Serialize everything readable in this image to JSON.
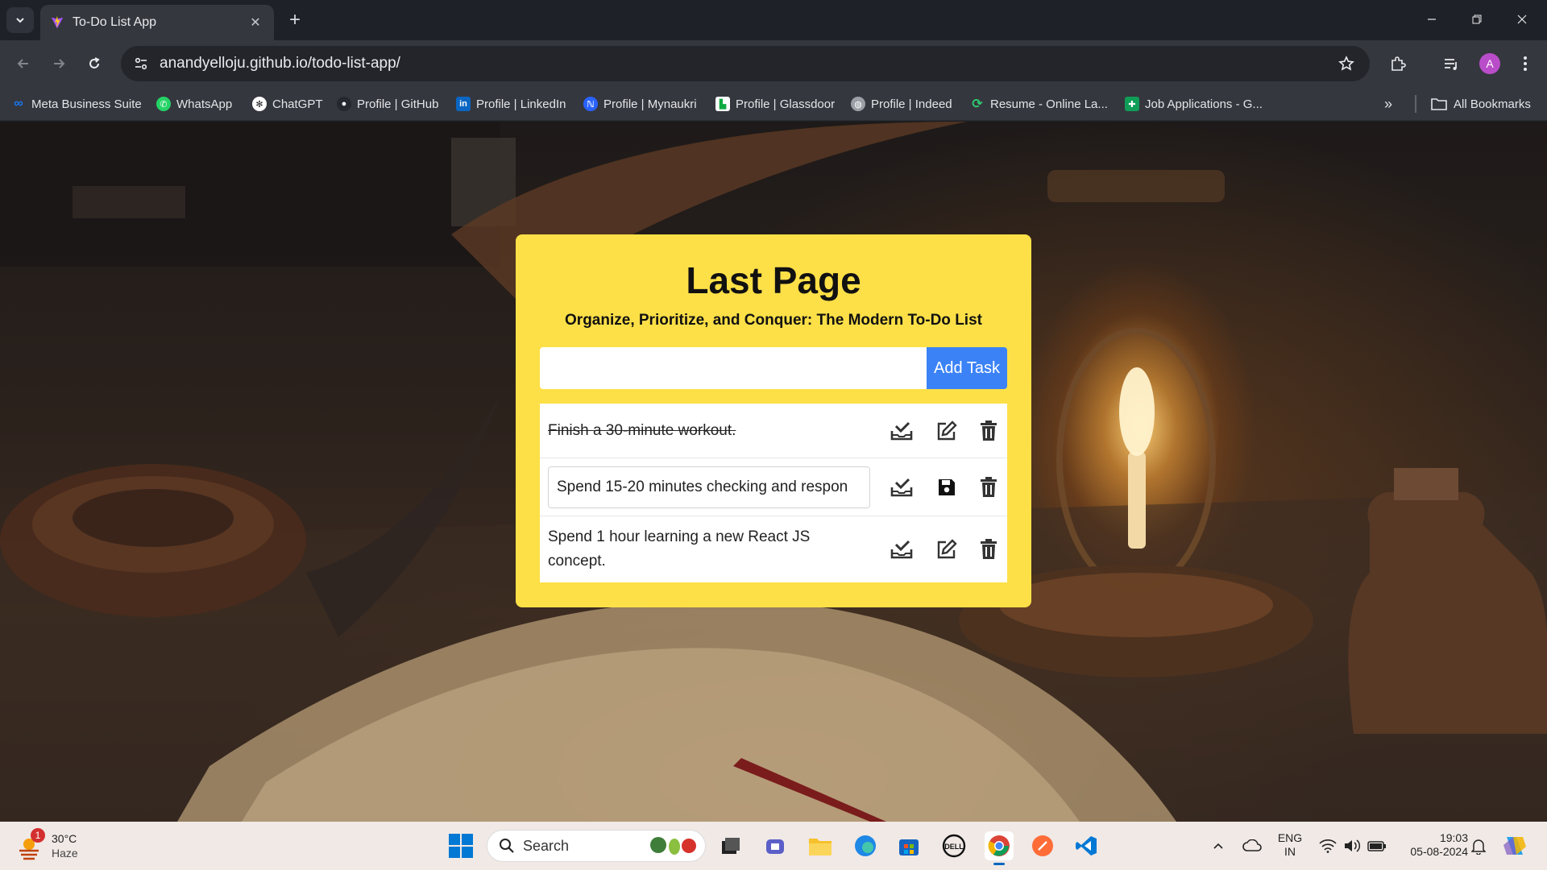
{
  "browser": {
    "tab_title": "To-Do List App",
    "url": "anandyelloju.github.io/todo-list-app/",
    "avatar_letter": "A",
    "bookmarks": [
      {
        "label": "Meta Business Suite",
        "icon": "meta-icon",
        "color": "#1877f2"
      },
      {
        "label": "WhatsApp",
        "icon": "whatsapp-icon",
        "color": "#25d366"
      },
      {
        "label": "ChatGPT",
        "icon": "chatgpt-icon",
        "color": "#e8eaed"
      },
      {
        "label": "Profile | GitHub",
        "icon": "github-icon",
        "color": "#24292f"
      },
      {
        "label": "Profile | LinkedIn",
        "icon": "linkedin-icon",
        "color": "#0a66c2"
      },
      {
        "label": "Profile | Mynaukri",
        "icon": "naukri-icon",
        "color": "#2962ff"
      },
      {
        "label": "Profile | Glassdoor",
        "icon": "glassdoor-icon",
        "color": "#0caa41"
      },
      {
        "label": "Profile | Indeed",
        "icon": "indeed-icon",
        "color": "#9aa0a6"
      },
      {
        "label": "Resume - Online La...",
        "icon": "resume-icon",
        "color": "#2ecc71"
      },
      {
        "label": "Job Applications - G...",
        "icon": "sheets-icon",
        "color": "#0f9d58"
      }
    ],
    "all_bookmarks_label": "All Bookmarks"
  },
  "app": {
    "title": "Last Page",
    "subtitle": "Organize, Prioritize, and Conquer: The Modern To-Do List",
    "input_value": "",
    "add_button_label": "Add Task",
    "tasks": [
      {
        "text": "Finish a 30-minute workout.",
        "state": "completed"
      },
      {
        "text": "Spend 15-20 minutes checking and respon",
        "state": "editing"
      },
      {
        "text": "Spend 1 hour learning a new React JS concept.",
        "state": "normal"
      }
    ]
  },
  "taskbar": {
    "weather_temp": "30°C",
    "weather_desc": "Haze",
    "weather_badge": "1",
    "search_label": "Search",
    "lang_line1": "ENG",
    "lang_line2": "IN",
    "time": "19:03",
    "date": "05-08-2024"
  },
  "colors": {
    "card": "#fde047",
    "add_button": "#3b82f6"
  }
}
